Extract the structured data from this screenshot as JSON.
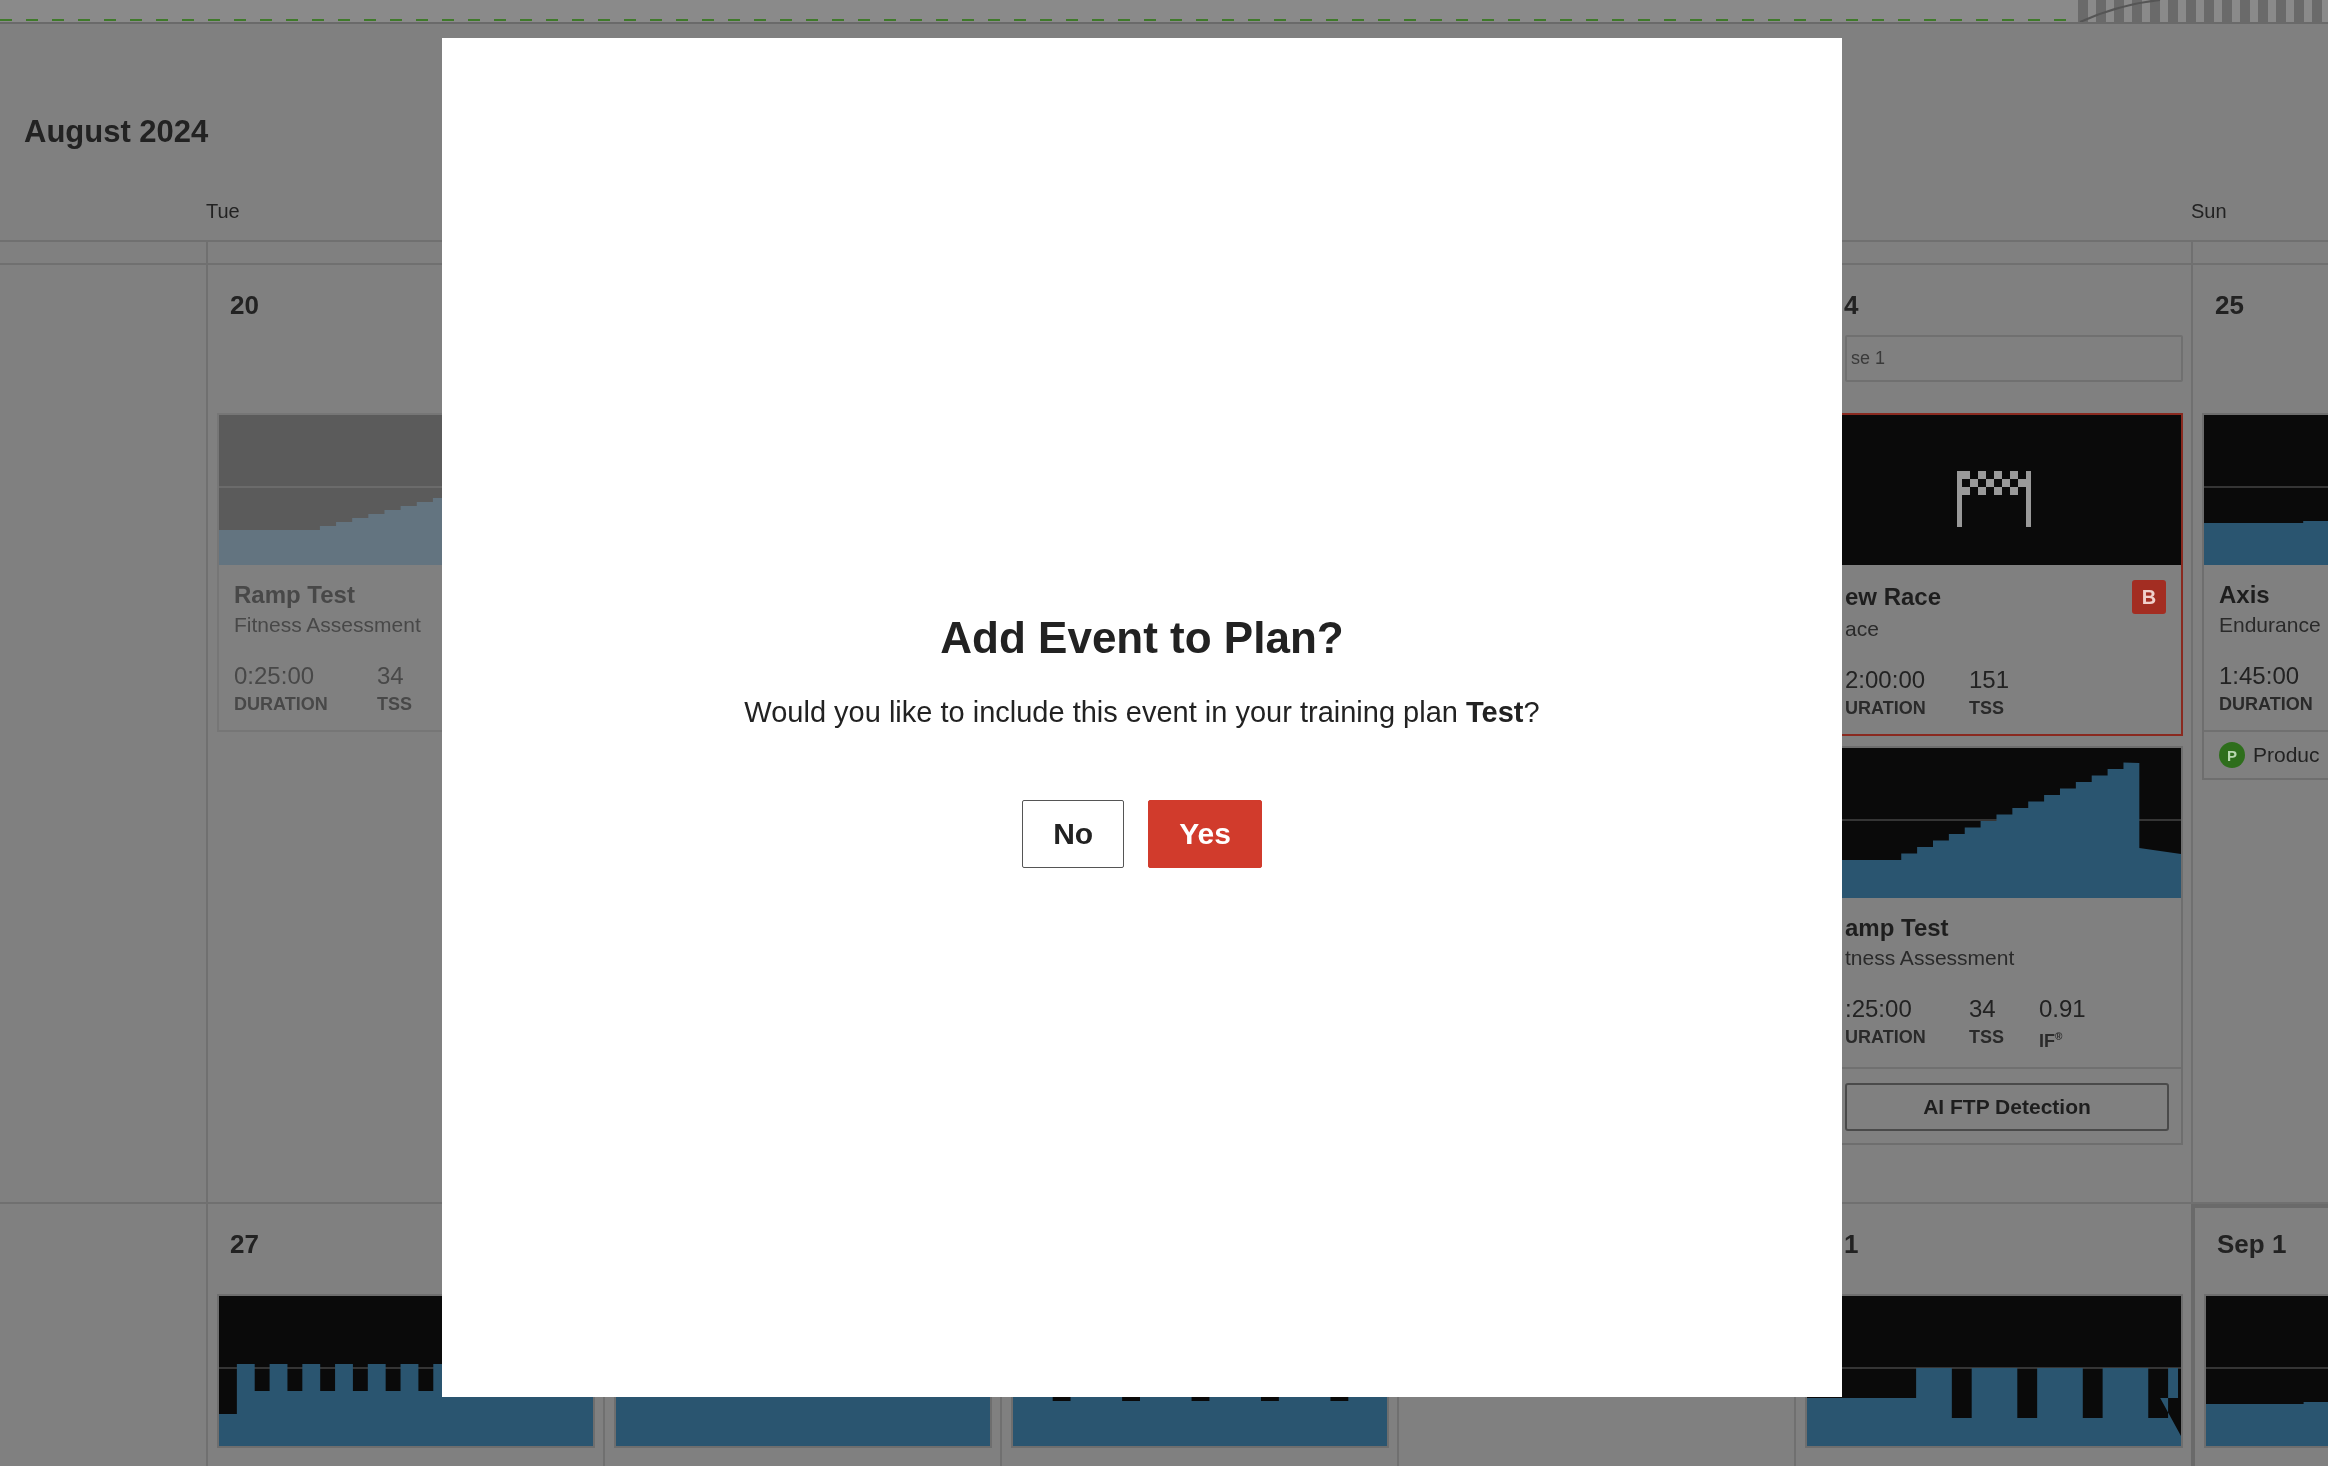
{
  "calendar": {
    "month_title": "August 2024",
    "weekdays": {
      "tue": "Tue",
      "sun": "Sun"
    },
    "weeks": [
      {
        "cells": {
          "tue": {
            "day": "20",
            "events": [
              {
                "kind": "ramp",
                "dimmed": true,
                "title": "Ramp Test",
                "subtitle": "Fitness Assessment",
                "metrics": [
                  {
                    "value": "0:25:00",
                    "label": "DURATION"
                  },
                  {
                    "value": "34",
                    "label": "TSS"
                  }
                ]
              }
            ]
          },
          "sat": {
            "day": "4",
            "phase": "se 1",
            "events": [
              {
                "kind": "race",
                "dimmed": false,
                "title": "ew Race",
                "subtitle": "ace",
                "priority": "B",
                "metrics": [
                  {
                    "value": "2:00:00",
                    "label": "URATION"
                  },
                  {
                    "value": "151",
                    "label": "TSS"
                  }
                ]
              },
              {
                "kind": "ramptest",
                "dimmed": false,
                "title": "amp Test",
                "subtitle": "tness Assessment",
                "metrics": [
                  {
                    "value": ":25:00",
                    "label": "URATION"
                  },
                  {
                    "value": "34",
                    "label": "TSS"
                  },
                  {
                    "value": "0.91",
                    "label": "IF$^{®}$"
                  }
                ],
                "action": "AI FTP Detection"
              }
            ]
          },
          "sun": {
            "day": "25",
            "events": [
              {
                "kind": "steady",
                "dimmed": false,
                "title": "Axis",
                "subtitle": "Endurance",
                "metrics": [
                  {
                    "value": "1:45:00",
                    "label": "DURATION"
                  }
                ],
                "tag": {
                  "badge": "P",
                  "label": "Produc"
                }
              }
            ]
          }
        }
      },
      {
        "cells": {
          "tue": {
            "day": "27",
            "events": [
              {
                "kind": "intervals",
                "dimmed": false
              }
            ]
          },
          "wed": {
            "events": [
              {
                "kind": "sprints",
                "dimmed": false
              }
            ]
          },
          "thu": {
            "events": [
              {
                "kind": "surges",
                "dimmed": false
              }
            ]
          },
          "sat": {
            "day": "1",
            "events": [
              {
                "kind": "blocks",
                "dimmed": false
              }
            ]
          },
          "sun": {
            "day": "Sep 1",
            "highlighted": true,
            "events": [
              {
                "kind": "steady",
                "dimmed": false
              }
            ]
          }
        }
      }
    ]
  },
  "dialog": {
    "title": "Add Event to Plan?",
    "message": "Would you like to include this event in your training plan **Test**?",
    "buttons": [
      {
        "label": "No",
        "kind": "secondary"
      },
      {
        "label": "Yes",
        "kind": "primary"
      }
    ]
  }
}
